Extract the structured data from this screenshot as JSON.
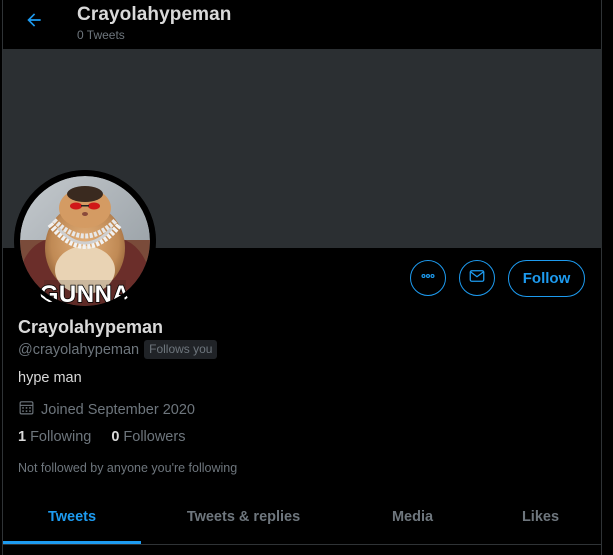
{
  "colors": {
    "accent": "#1d9bf0",
    "background": "#000000",
    "banner": "#2b2f32",
    "muted_text": "#6e767d",
    "primary_text": "#d9d9d9"
  },
  "header": {
    "title": "Crayolahypeman",
    "subtitle": "0 Tweets",
    "back_icon": "arrow-left-icon"
  },
  "profile": {
    "avatar_caption": "GUNNA",
    "display_name": "Crayolahypeman",
    "handle": "@crayolahypeman",
    "follows_you_badge": "Follows you",
    "bio": "hype man",
    "joined": "Joined September 2020",
    "following_count": "1",
    "following_label": "Following",
    "followers_count": "0",
    "followers_label": "Followers",
    "not_followed_text": "Not followed by anyone you're following"
  },
  "actions": {
    "more_icon": "more-horizontal-icon",
    "message_icon": "envelope-icon",
    "follow_label": "Follow"
  },
  "tabs": [
    {
      "label": "Tweets",
      "active": true
    },
    {
      "label": "Tweets & replies",
      "active": false
    },
    {
      "label": "Media",
      "active": false
    },
    {
      "label": "Likes",
      "active": false
    }
  ]
}
